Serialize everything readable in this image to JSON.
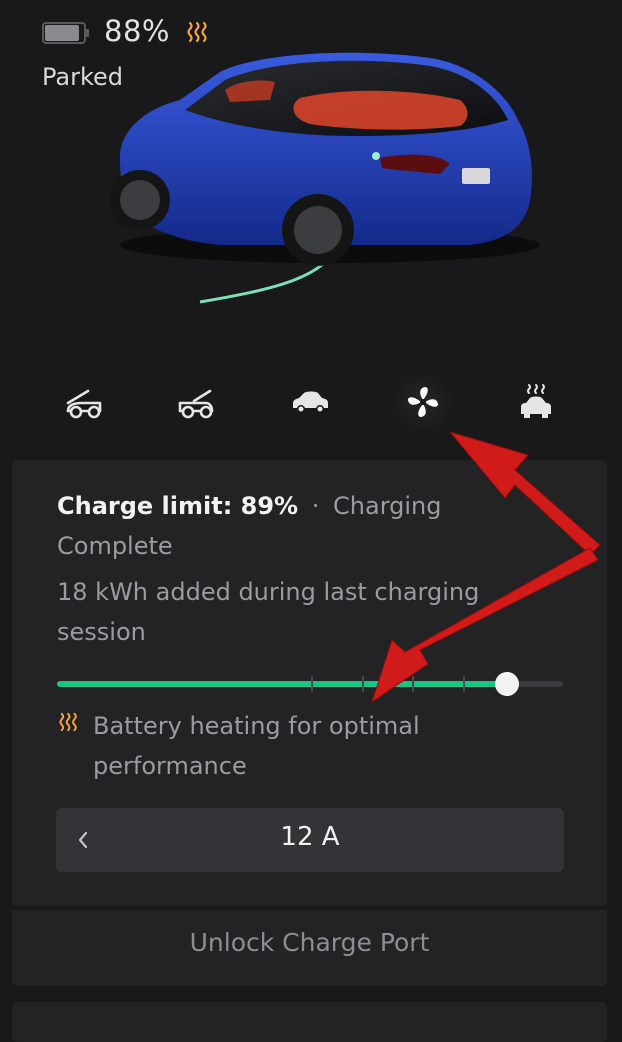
{
  "status": {
    "battery_percent": "88%",
    "battery_fill_fraction": 0.88,
    "state": "Parked",
    "heat_icon": "battery-heating-icon"
  },
  "controls": [
    {
      "name": "frunk",
      "icon": "frunk-open-icon"
    },
    {
      "name": "trunk",
      "icon": "trunk-open-icon"
    },
    {
      "name": "car",
      "icon": "car-icon"
    },
    {
      "name": "climate",
      "icon": "fan-icon",
      "active": true
    },
    {
      "name": "defrost",
      "icon": "heated-car-icon"
    }
  ],
  "charging": {
    "limit_label": "Charge limit: 89%",
    "separator": "·",
    "status_line1": "Charging",
    "status_line2": "Complete",
    "session_line1": "18 kWh added during last charging",
    "session_line2": "session",
    "charge_limit_fraction": 0.89,
    "heating_line1": "Battery heating for optimal",
    "heating_line2": "performance",
    "current": "12 A",
    "unlock_label": "Unlock Charge Port"
  },
  "colors": {
    "background": "#19191b",
    "card": "#232326",
    "accent_green": "#16c784",
    "heat_orange": "#f2a43a",
    "annotation_red": "#d11a1a",
    "car_blue": "#1f3fb3"
  }
}
